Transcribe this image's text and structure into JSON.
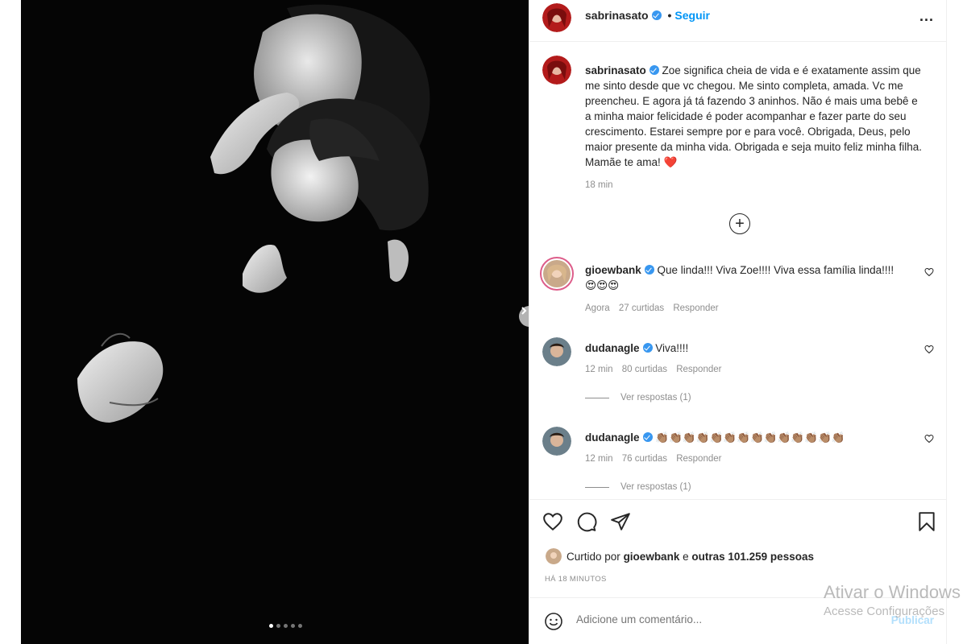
{
  "post": {
    "author": "sabrinasato",
    "follow_label": "Seguir",
    "separator": "•",
    "more": "...",
    "caption": "Zoe significa cheia de vida e é exatamente assim que me sinto desde que vc chegou. Me sinto completa, amada. Vc me preencheu. E agora já tá fazendo 3 aninhos. Não é mais uma bebê e a minha maior felicidade é poder acompanhar e fazer parte do seu crescimento. Estarei sempre por e para você. Obrigada, Deus, pelo maior presente da minha vida. Obrigada e seja muito feliz minha filha. Mamãe te ama!",
    "caption_emoji": "❤️",
    "caption_time": "18 min",
    "load_more_label": "+",
    "carousel": {
      "total": 5,
      "current": 1
    }
  },
  "comments": [
    {
      "user": "gioewbank",
      "text": "Que linda!!! Viva Zoe!!!! Viva essa família linda!!!!",
      "emoji": "😍😍😍",
      "time": "Agora",
      "likes": "27 curtidas",
      "reply": "Responder",
      "view_replies": ""
    },
    {
      "user": "dudanagle",
      "text": "Viva!!!!",
      "emoji": "",
      "time": "12 min",
      "likes": "80 curtidas",
      "reply": "Responder",
      "view_replies": "Ver respostas (1)"
    },
    {
      "user": "dudanagle",
      "text": "👏🏽👏🏽👏🏽👏🏽👏🏽👏🏽👏🏽👏🏽👏🏽👏🏽👏🏽👏🏽👏🏽👏🏽",
      "emoji": "",
      "time": "12 min",
      "likes": "76 curtidas",
      "reply": "Responder",
      "view_replies": "Ver respostas (1)"
    }
  ],
  "likes_summary": {
    "prefix": "Curtido por",
    "user": "gioewbank",
    "middle": "e",
    "others": "outras 101.259 pessoas"
  },
  "posted_time": "HÁ 18 MINUTOS",
  "comment_input": {
    "placeholder": "Adicione um comentário..."
  },
  "publish_label": "Publicar",
  "watermark": {
    "line1": "Ativar o Windows",
    "line2": "Acesse Configurações"
  },
  "icons": [
    "heart-icon",
    "comment-icon",
    "share-icon",
    "bookmark-icon",
    "smile-icon",
    "chevron-right-icon",
    "verified-icon",
    "more-icon"
  ],
  "colors": {
    "accent": "#0095f6",
    "verified": "#3897f0",
    "muted": "#8e8e8e",
    "photo_bg": "#050505"
  }
}
